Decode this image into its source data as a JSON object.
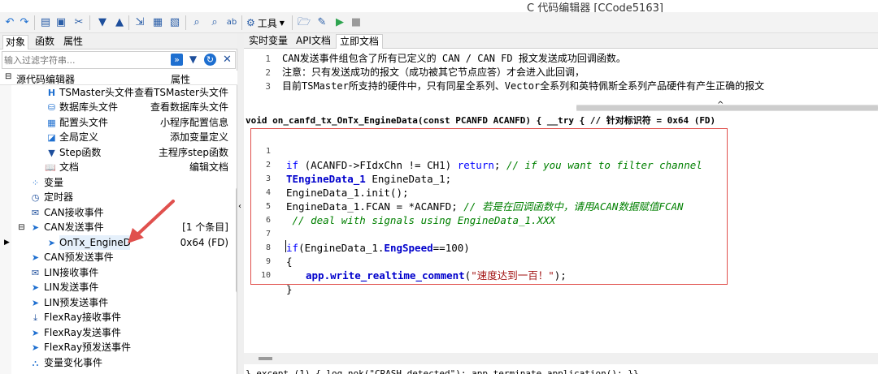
{
  "window": {
    "title": "C 代码编辑器 [CCode5163]"
  },
  "toolbar": {
    "icons": [
      "undo-icon",
      "redo-icon",
      "copy-icon",
      "paste-icon",
      "cut-icon",
      "move-down-icon",
      "move-up-icon",
      "import-icon",
      "save-icon",
      "save-as-icon",
      "find-icon",
      "find-replace-icon",
      "replace-icon",
      "tools-icon",
      "open-icon",
      "edit-icon",
      "run-icon",
      "stop-icon"
    ],
    "tools_label": "工具"
  },
  "left": {
    "tabs": [
      "对象",
      "函数",
      "属性"
    ],
    "filter_placeholder": "输入过滤字符串...",
    "header": {
      "col1": "源代码编辑器",
      "col2": "属性"
    },
    "rows": [
      {
        "label": "TSMaster头文件",
        "value": "查看TSMaster头文件",
        "icon": "header-file-icon"
      },
      {
        "label": "数据库头文件",
        "value": "查看数据库头文件",
        "icon": "database-icon"
      },
      {
        "label": "配置头文件",
        "value": "小程序配置信息",
        "icon": "config-icon"
      },
      {
        "label": "全局定义",
        "value": "添加变量定义",
        "icon": "global-icon"
      },
      {
        "label": "Step函数",
        "value": "主程序step函数",
        "icon": "step-icon"
      },
      {
        "label": "文档",
        "value": "编辑文档",
        "icon": "book-icon"
      },
      {
        "label": "变量",
        "value": "",
        "icon": "variable-icon"
      },
      {
        "label": "定时器",
        "value": "",
        "icon": "timer-icon"
      },
      {
        "label": "CAN接收事件",
        "value": "",
        "icon": "mail-icon"
      },
      {
        "label": "CAN发送事件",
        "value": "[1 个条目]",
        "icon": "send-icon"
      },
      {
        "label": "OnTx_EngineData",
        "value": "0x64 (FD)",
        "icon": "send-icon"
      },
      {
        "label": "CAN预发送事件",
        "value": "",
        "icon": "send-icon"
      },
      {
        "label": "LIN接收事件",
        "value": "",
        "icon": "mail-icon"
      },
      {
        "label": "LIN发送事件",
        "value": "",
        "icon": "send-icon"
      },
      {
        "label": "LIN预发送事件",
        "value": "",
        "icon": "send-icon"
      },
      {
        "label": "FlexRay接收事件",
        "value": "",
        "icon": "receive-icon"
      },
      {
        "label": "FlexRay发送事件",
        "value": "",
        "icon": "send-icon"
      },
      {
        "label": "FlexRay预发送事件",
        "value": "",
        "icon": "send-icon"
      },
      {
        "label": "变量变化事件",
        "value": "",
        "icon": "network-icon"
      }
    ]
  },
  "right": {
    "tabs": [
      "实时变量",
      "API文档",
      "立即文档"
    ],
    "doc_lines": [
      {
        "n": "1",
        "text": "CAN发送事件组包含了所有已定义的 CAN / CAN FD 报文发送成功回调函数。"
      },
      {
        "n": "2",
        "text": "注意：只有发送成功的报文（成功被其它节点应答）才会进入此回调，"
      },
      {
        "n": "3",
        "text": "目前TSMaster所支持的硬件中，只有同星全系列、Vector全系列和英特佩斯全系列产品硬件有产生正确的报文"
      }
    ],
    "signature": "void on_canfd_tx_OnTx_EngineData(const PCANFD ACANFD) { __try {  // 针对标识符 = 0x64 (FD)",
    "code_line_numbers": [
      "1",
      "2",
      "3",
      "4",
      "5",
      "6",
      "7",
      "8",
      "9",
      "10"
    ],
    "code": {
      "l1a": "if",
      "l1b": " (ACANFD->FIdxChn != CH1) ",
      "l1c": "return",
      "l1d": "; ",
      "l1e": "// if you want to filter channel",
      "l2a": "TEngineData_1",
      "l2b": " EngineData_1;",
      "l3": "EngineData_1.init();",
      "l4a": "EngineData_1.FCAN = *ACANFD; ",
      "l4b": "// 若是在回调函数中，请用ACAN数据赋值FCAN",
      "l5": " // deal with signals using EngineData_1.XXX",
      "l7a": "if",
      "l7b": "(EngineData_1.",
      "l7c": "EngSpeed",
      "l7d": "==100)",
      "l8": "{",
      "l9a": "app.write_realtime_comment",
      "l9b": "(",
      "l9c": "\"速度达到一百！\"",
      "l9d": ");",
      "l10": "}"
    },
    "bottom_code": "}  except (1) { log_nok(\"CRASH detected\"); app.terminate_application(); }}"
  },
  "colors": {
    "annotation_red": "#e0504d",
    "selection": "#e5f0fb",
    "accent_blue": "#1e6fd0"
  }
}
